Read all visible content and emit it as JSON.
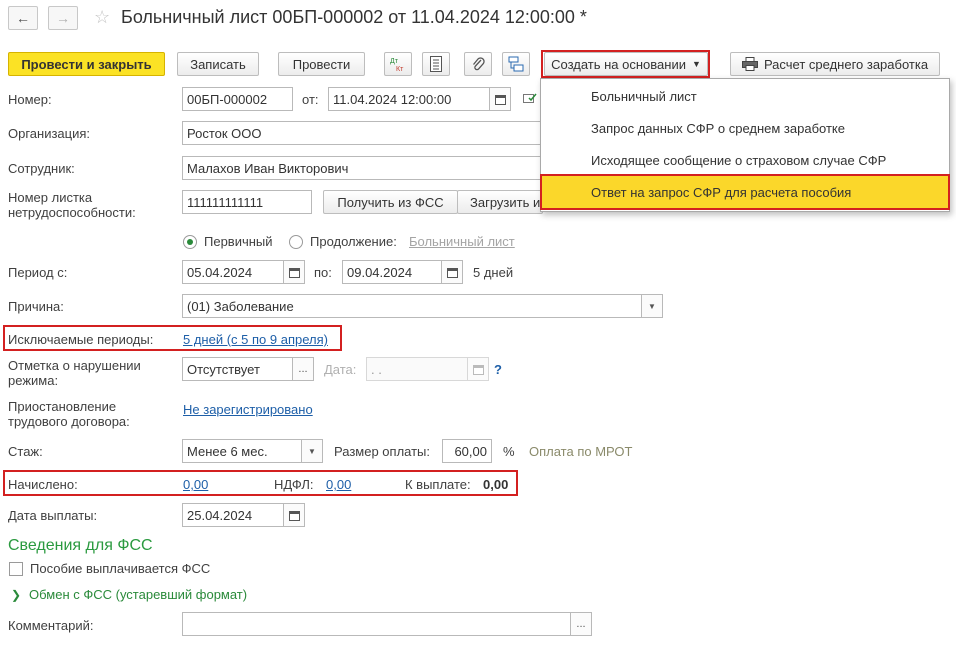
{
  "header": {
    "title": "Больничный лист 00БП-000002 от 11.04.2024 12:00:00 *",
    "back_icon": "←",
    "forward_icon": "→",
    "star_icon": "☆"
  },
  "toolbar": {
    "post_close": "Провести и закрыть",
    "save": "Записать",
    "post": "Провести",
    "dt_kt_icon": "dt-kt-icon",
    "create_based_on": "Создать на основании",
    "avg_earnings": "Расчет среднего заработка"
  },
  "dropdown": {
    "items": [
      "Больничный лист",
      "Запрос данных СФР о среднем заработке",
      "Исходящее сообщение о страховом случае СФР",
      "Ответ на запрос СФР для расчета пособия"
    ]
  },
  "form": {
    "number_label": "Номер:",
    "number_value": "00БП-000002",
    "from_label": "от:",
    "date_value": "11.04.2024 12:00:00",
    "org_label": "Организация:",
    "org_value": "Росток ООО",
    "employee_label": "Сотрудник:",
    "employee_value": "Малахов Иван Викторович",
    "sheet_label_1": "Номер листка",
    "sheet_label_2": "нетрудоспособности:",
    "sheet_value": "111111111111",
    "get_fss": "Получить из ФСС",
    "load_from": "Загрузить из",
    "primary_label": "Первичный",
    "continuation_label": "Продолжение:",
    "continuation_link": "Больничный лист",
    "period_label": "Период с:",
    "period_from": "05.04.2024",
    "period_to_label": "по:",
    "period_to": "09.04.2024",
    "period_days": "5 дней",
    "reason_label": "Причина:",
    "reason_value": "(01) Заболевание",
    "excluded_label": "Исключаемые периоды:",
    "excluded_link": "5 дней (с 5 по 9 апреля)",
    "violation_label_1": "Отметка о нарушении",
    "violation_label_2": "режима:",
    "violation_value": "Отсутствует",
    "violation_date_label": "Дата:",
    "violation_date_value": " .  .",
    "help": "?",
    "suspension_label_1": "Приостановление",
    "suspension_label_2": "трудового договора:",
    "suspension_link": "Не зарегистрировано",
    "experience_label": "Стаж:",
    "experience_value": "Менее 6 мес.",
    "pay_size_label": "Размер оплаты:",
    "pay_size_value": "60,00",
    "percent": "%",
    "mrot_note": "Оплата по МРОТ",
    "accrued_label": "Начислено:",
    "accrued_value": "0,00",
    "ndfl_label": "НДФЛ:",
    "ndfl_value": "0,00",
    "to_pay_label": "К выплате:",
    "to_pay_value": "0,00",
    "pay_date_label": "Дата выплаты:",
    "pay_date_value": "25.04.2024",
    "fss_section": "Сведения для ФСС",
    "fss_benefit": "Пособие выплачивается ФСС",
    "fss_exchange": "Обмен с ФСС (устаревший формат)",
    "comment_label": "Комментарий:",
    "comment_value": ""
  },
  "colors": {
    "primary_button": "#fbe225",
    "highlight_frame": "#d32020",
    "link": "#1e5fa8",
    "section_green": "#2a9a3f",
    "menu_active": "#fbd72a"
  }
}
